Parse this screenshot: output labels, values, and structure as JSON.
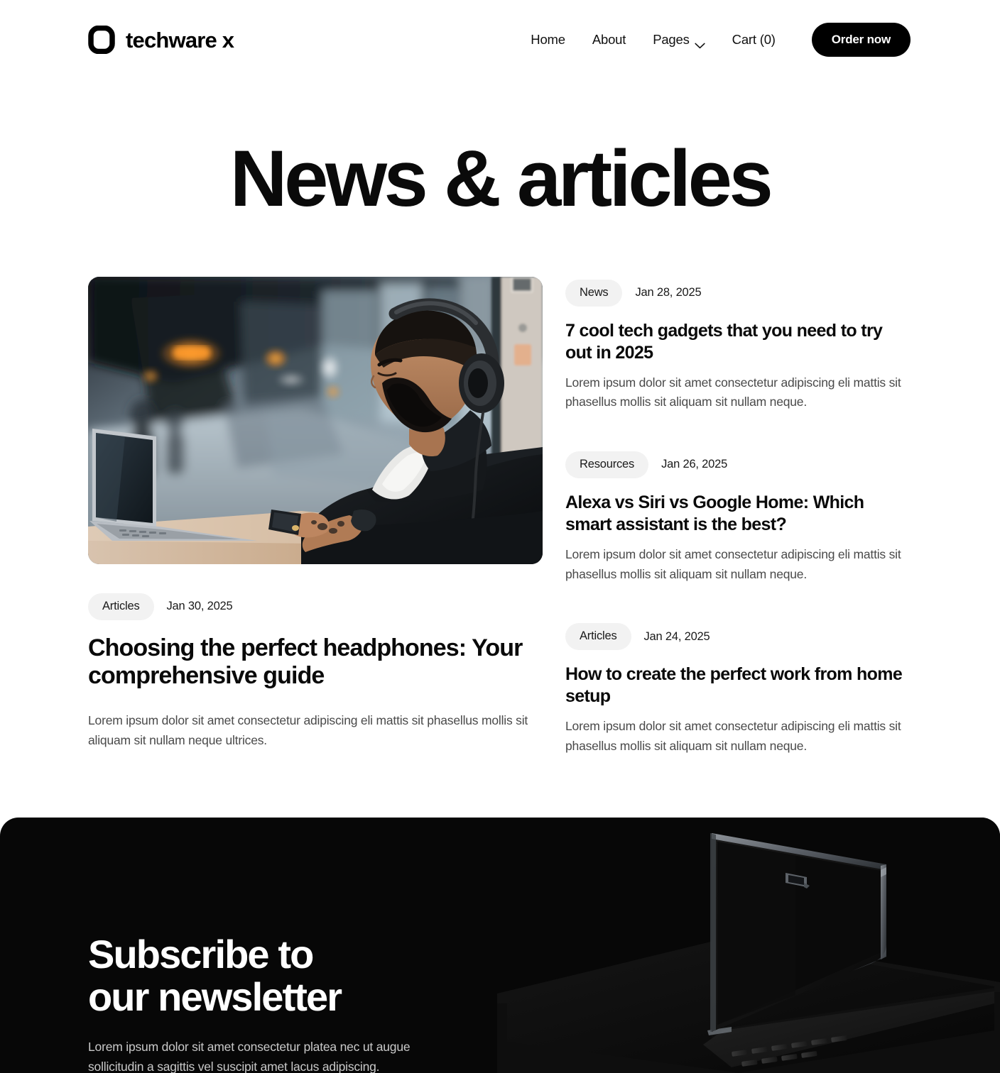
{
  "header": {
    "logo_icon": "rounded-square-o-icon",
    "brand_name": "techware x",
    "nav": [
      {
        "label": "Home",
        "icon": null
      },
      {
        "label": "About",
        "icon": null
      },
      {
        "label": "Pages",
        "icon": "chevron-down-icon"
      },
      {
        "label": "Cart (0)",
        "icon": null
      }
    ],
    "cta_label": "Order now"
  },
  "main": {
    "page_title": "News & articles",
    "featured": {
      "image_alt": "Man with headphones working on a laptop at a train station",
      "tag": "Articles",
      "date": "Jan 30, 2025",
      "title": "Choosing the perfect headphones: Your comprehensive guide",
      "excerpt": "Lorem ipsum dolor sit amet consectetur adipiscing eli mattis sit phasellus mollis sit aliquam sit nullam neque ultrices."
    },
    "articles": [
      {
        "tag": "News",
        "date": "Jan 28, 2025",
        "title": "7 cool tech gadgets that you need to try out in 2025",
        "excerpt": "Lorem ipsum dolor sit amet consectetur adipiscing eli mattis sit phasellus mollis sit aliquam sit nullam neque."
      },
      {
        "tag": "Resources",
        "date": "Jan 26, 2025",
        "title": "Alexa vs Siri vs Google Home: Which smart assistant is the best?",
        "excerpt": "Lorem ipsum dolor sit amet consectetur adipiscing eli mattis sit phasellus mollis sit aliquam sit nullam neque."
      },
      {
        "tag": "Articles",
        "date": "Jan 24, 2025",
        "title": "How to create the perfect work from home setup",
        "excerpt": "Lorem ipsum dolor sit amet consectetur adipiscing eli mattis sit phasellus mollis sit aliquam sit nullam neque."
      }
    ]
  },
  "newsletter": {
    "title": "Subscribe to\nour newsletter",
    "subtitle": "Lorem ipsum dolor sit amet consectetur platea nec ut augue\nsollicitudin a sagittis vel suscipit amet lacus adipiscing.",
    "image_alt": "Dark open laptop on black background"
  },
  "colors": {
    "accent": "#000000",
    "page_bg": "#ffffff",
    "tag_bg": "#f2f2f2",
    "body_text": "#4a4a4a",
    "heading_text": "#0a0a0a",
    "newsletter_bg": "#070707",
    "newsletter_sub": "#c9c9c9"
  }
}
